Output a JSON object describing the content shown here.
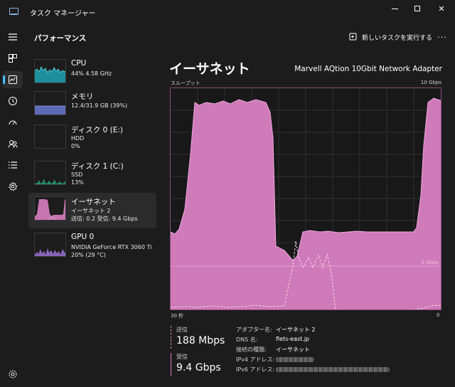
{
  "window": {
    "title": "タスク マネージャー",
    "accent": "#4cc2ff"
  },
  "nav": {
    "icons": [
      "hamburger-icon",
      "processes-icon",
      "performance-icon",
      "history-icon",
      "startup-icon",
      "users-icon",
      "details-icon",
      "services-icon",
      "settings-icon"
    ],
    "active": "performance-icon"
  },
  "header": {
    "page_title": "パフォーマンス",
    "run_task_label": "新しいタスクを実行する",
    "more_label": "..."
  },
  "resources": [
    {
      "name": "CPU",
      "line1": "44% 4.58 GHz",
      "line2": "",
      "color": "#1fa3b3"
    },
    {
      "name": "メモリ",
      "line1": "12.4/31.9 GB (39%)",
      "line2": "",
      "color": "#6a78d1"
    },
    {
      "name": "ディスク 0 (E:)",
      "line1": "HDD",
      "line2": "0%",
      "color": "#2aa17a"
    },
    {
      "name": "ディスク 1 (C:)",
      "line1": "SSD",
      "line2": "13%",
      "color": "#2aa17a"
    },
    {
      "name": "イーサネット",
      "line1": "イーサネット 2",
      "line2": "送信: 0.2 受信: 9.4 Gbps",
      "color": "#e08fd1",
      "selected": true
    },
    {
      "name": "GPU 0",
      "line1": "NVIDIA GeForce RTX 3060 Ti",
      "line2": "20% (29 °C)",
      "color": "#9a72d6"
    }
  ],
  "detail": {
    "title": "イーサネット",
    "adapter": "Marvell AQtion 10Gbit Network Adapter",
    "graph_label": "スループット",
    "graph_max": "10 Gbps",
    "graph_time": "30 秒",
    "graph_zero": "0",
    "graph_marker": "2 Gbps",
    "fill_color": "#d97fc2"
  },
  "stats": {
    "send_label": "送信",
    "send_value": "188 Mbps",
    "recv_label": "受信",
    "recv_value": "9.4 Gbps"
  },
  "properties": [
    {
      "key": "アダプター名:",
      "value": "イーサネット 2"
    },
    {
      "key": "DNS 名:",
      "value": "flets-east.jp"
    },
    {
      "key": "接続の種類:",
      "value": "イーサネット"
    },
    {
      "key": "IPv4 アドレス:",
      "value": ""
    },
    {
      "key": "IPv6 アドレス:",
      "value": ""
    }
  ]
}
